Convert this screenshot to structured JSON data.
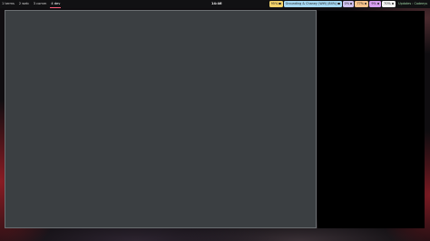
{
  "topbar": {
    "workspaces": [
      {
        "label": "1 terms",
        "active": false
      },
      {
        "label": "2 web",
        "active": false
      },
      {
        "label": "3 comm",
        "active": false
      },
      {
        "label": "4 dev",
        "active": true
      }
    ],
    "clock": "14:46",
    "modules": {
      "battery": "95%",
      "wifi": "Grounding & Chaney (Wifi) (84%)",
      "cpu": "0%",
      "temp": "77%",
      "memory": "9%",
      "volume": "70%",
      "updates": "Updates : Cadeeys"
    }
  },
  "colors": {
    "active_workspace_underline": "#ff5d7a",
    "battery": "#f3d36b",
    "wifi": "#a6d8f2",
    "cpu": "#cfc2f0",
    "temp": "#f7c48c",
    "memory": "#d79ef0",
    "volume": "#f4f4f4",
    "left_window": "#3b3f42",
    "right_window": "#000000"
  },
  "icons": {
    "battery": "battery-icon",
    "wifi": "wifi-icon",
    "cpu": "cpu-icon",
    "temp": "thermometer-icon",
    "memory": "memory-icon",
    "volume": "volume-icon"
  }
}
